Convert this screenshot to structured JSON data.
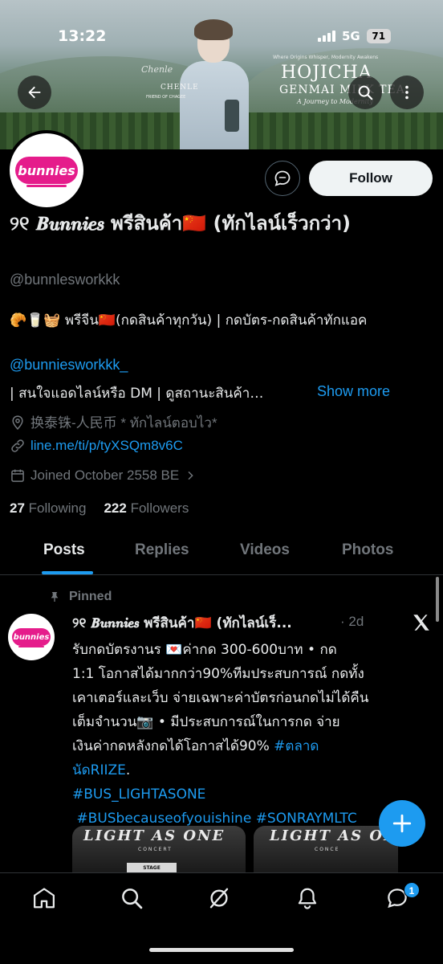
{
  "status_bar": {
    "time": "13:22",
    "network": "5G",
    "battery": "71"
  },
  "banner": {
    "signature": "Chenle",
    "brand": "CHENLE",
    "brand_sub": "FRIEND OF CHAGEE",
    "tagline": "Where Origins Whisper, Modernity Awakens",
    "title": "HOJICHA",
    "title2": "GENMAI MILK TEA",
    "title3": "A Journey to Modernity"
  },
  "profile": {
    "avatar_text": "bunnies",
    "follow_label": "Follow",
    "display_name": "୨୧ 𝑩𝒖𝒏𝒏𝒊𝒆𝒔 พรีสินค้า🇨🇳 (ทักไลน์เร็วกว่า)",
    "handle": "@bunnlesworkkk",
    "bio_line1": "🥐🥛🧺 พรีจีน🇨🇳(กดสินค้าทุกวัน) | กดบัตร-กดสินค้าทักแอค",
    "bio_mention": "@bunniesworkkk_",
    "bio_line2": "| สนใจแอดไลน์หรือ DM | ดูสถานะสินค้า…",
    "show_more": "Show more",
    "location": "换泰铢-人民币 * ทักไลน์ตอบไว*",
    "website": "line.me/ti/p/tyXSQm8v6C",
    "joined": "Joined October 2558 BE",
    "following_count": "27",
    "following_label": "Following",
    "followers_count": "222",
    "followers_label": "Followers"
  },
  "tabs": [
    {
      "label": "Posts"
    },
    {
      "label": "Replies"
    },
    {
      "label": "Videos"
    },
    {
      "label": "Photos"
    }
  ],
  "pinned_tweet": {
    "pinned_label": "Pinned",
    "author": "୨୧ 𝑩𝒖𝒏𝒏𝒊𝒆𝒔 พรีสินค้า🇨🇳 (ทักไลน์เร็...",
    "time": "· 2d",
    "lines": [
      "รับกดบัตรงานร 💌ค่ากด 300-600บาท    • กด",
      "1:1 โอกาสได้มากกว่า90%ทีมประสบการณ์ กดทั้ง",
      "เคาเตอร์และเว็บ จ่ายเฉพาะค่าบัตรก่อนกดไม่ได้คืน",
      "เต็มจำนวน📷   • มีประสบการณ์ในการกด   จ่าย",
      "เงินค่ากดหลังกดได้โอกาสได้90% "
    ],
    "hashtag1a": "#ตลาด",
    "hashtag1b": "นัดRIIZE",
    "line6_tail": ".",
    "hashtag2": "#BUS_LIGHTASONE",
    "hashtag3": "#BUSbecauseofyouishine #SONRAYMLTC",
    "media1_word": "LIGHT AS ONE",
    "media1_sub": "CONCERT",
    "media1_stage": "STAGE",
    "media2_word": "LIGHT AS ONE",
    "media2_sub": "CONCE"
  },
  "bottom_nav": {
    "items": [
      "home-icon",
      "search-icon",
      "grok-icon",
      "notifications-icon",
      "messages-icon"
    ],
    "messages_badge": "1"
  },
  "colors": {
    "accent": "#1d9bf0",
    "background": "#000000",
    "muted": "#71767b",
    "brand_pink": "#e51c8b"
  }
}
